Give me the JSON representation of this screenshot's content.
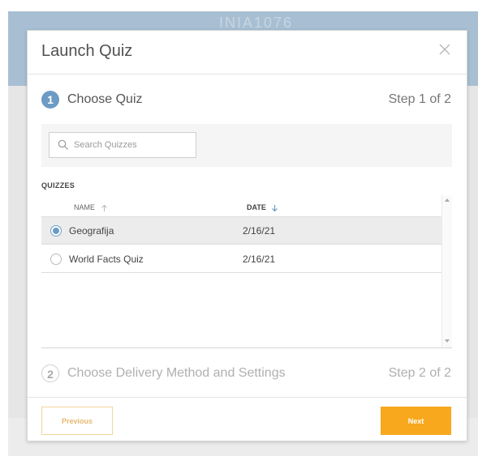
{
  "background": {
    "faint_title": "INIA1076"
  },
  "modal": {
    "title": "Launch Quiz",
    "close_icon": "close-icon"
  },
  "step1": {
    "number": "1",
    "label": "Choose Quiz",
    "step_text": "Step 1 of 2"
  },
  "search": {
    "placeholder": "Search Quizzes",
    "value": ""
  },
  "quizzes": {
    "section_label": "QUIZZES",
    "columns": {
      "name": "NAME",
      "date": "DATE"
    },
    "rows": [
      {
        "name": "Geografija",
        "date": "2/16/21",
        "selected": true
      },
      {
        "name": "World Facts Quiz",
        "date": "2/16/21",
        "selected": false
      }
    ]
  },
  "step2": {
    "number": "2",
    "label": "Choose Delivery Method and Settings",
    "step_text": "Step 2 of 2"
  },
  "footer": {
    "previous_label": "Previous",
    "next_label": "Next"
  },
  "colors": {
    "accent": "#6c9bc4",
    "primary_button": "#f7a81d",
    "header_band": "#a8bfd3"
  }
}
